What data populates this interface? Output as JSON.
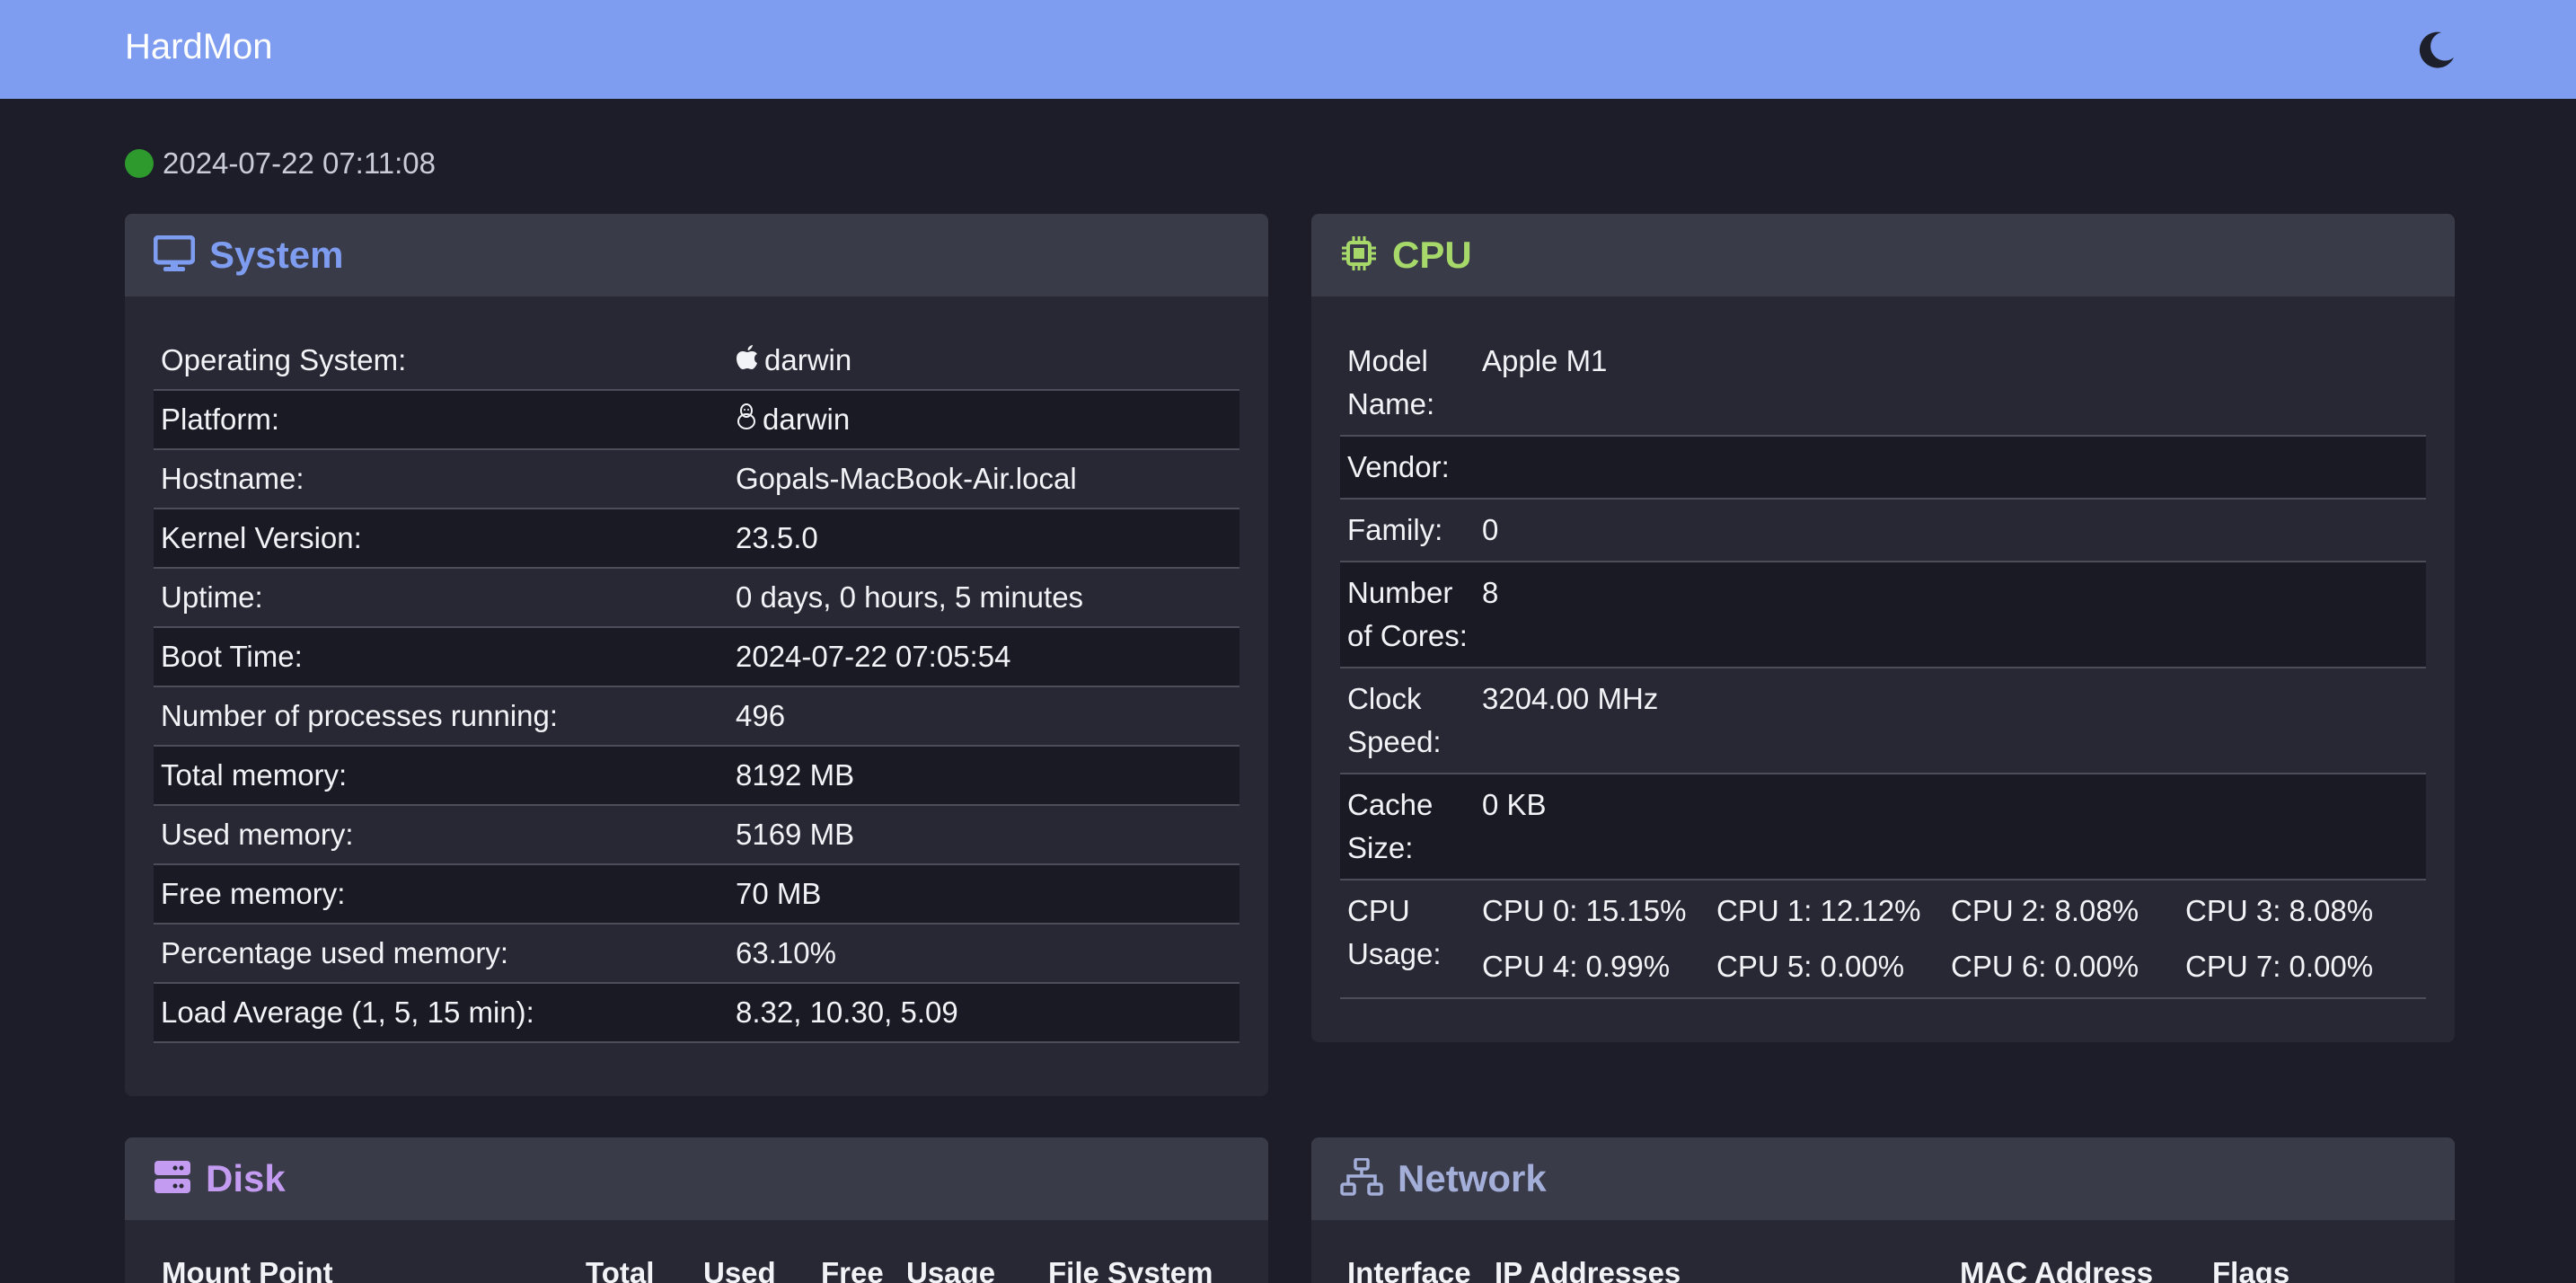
{
  "navbar": {
    "brand": "HardMon",
    "theme_icon": "moon-icon",
    "background": "#7e9df0"
  },
  "status": {
    "timestamp": "2024-07-22 07:11:08",
    "indicator_color": "#2e9a2e"
  },
  "system": {
    "title": "System",
    "icon": "monitor-icon",
    "accent": "#7e9df0",
    "rows": [
      {
        "key": "Operating System:",
        "value": "darwin",
        "icon": "apple-icon"
      },
      {
        "key": "Platform:",
        "value": "darwin",
        "icon": "linux-icon"
      },
      {
        "key": "Hostname:",
        "value": "Gopals-MacBook-Air.local"
      },
      {
        "key": "Kernel Version:",
        "value": "23.5.0"
      },
      {
        "key": "Uptime:",
        "value": "0 days, 0 hours, 5 minutes"
      },
      {
        "key": "Boot Time:",
        "value": "2024-07-22 07:05:54"
      },
      {
        "key": "Number of processes running:",
        "value": "496"
      },
      {
        "key": "Total memory:",
        "value": "8192 MB"
      },
      {
        "key": "Used memory:",
        "value": "5169 MB"
      },
      {
        "key": "Free memory:",
        "value": "70 MB"
      },
      {
        "key": "Percentage used memory:",
        "value": "63.10%"
      },
      {
        "key": "Load Average (1, 5, 15 min):",
        "value": "8.32, 10.30, 5.09"
      }
    ]
  },
  "cpu": {
    "title": "CPU",
    "icon": "cpu-chip-icon",
    "accent": "#a6d86a",
    "rows": [
      {
        "key": "Model Name:",
        "value": "Apple M1"
      },
      {
        "key": "Vendor:",
        "value": ""
      },
      {
        "key": "Family:",
        "value": "0"
      },
      {
        "key": "Number of Cores:",
        "value": "8"
      },
      {
        "key": "Clock Speed:",
        "value": "3204.00 MHz"
      },
      {
        "key": "Cache Size:",
        "value": "0 KB"
      }
    ],
    "usage_label": "CPU Usage:",
    "usage": [
      "CPU 0: 15.15%",
      "CPU 1: 12.12%",
      "CPU 2: 8.08%",
      "CPU 3: 8.08%",
      "CPU 4: 0.99%",
      "CPU 5: 0.00%",
      "CPU 6: 0.00%",
      "CPU 7: 0.00%"
    ]
  },
  "disk": {
    "title": "Disk",
    "icon": "server-icon",
    "accent": "#c39cf2",
    "columns": [
      "Mount Point",
      "Total",
      "Used",
      "Free",
      "Usage",
      "File System"
    ]
  },
  "network": {
    "title": "Network",
    "icon": "network-icon",
    "accent": "#a3aed9",
    "columns": [
      "Interface",
      "IP Addresses",
      "MAC Address",
      "Flags"
    ]
  }
}
